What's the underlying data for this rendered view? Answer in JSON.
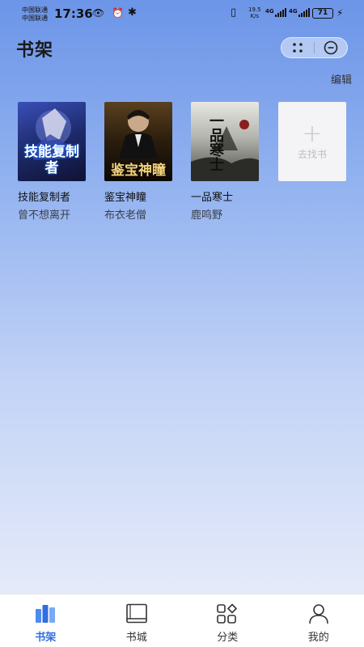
{
  "status_bar": {
    "carrier_1": "中国联通",
    "carrier_2": "中国联通",
    "time": "17:36",
    "net_speed_value": "19.5",
    "net_speed_unit": "K/s",
    "net_type_1": "4G",
    "net_type_2": "4G",
    "battery": "71"
  },
  "header": {
    "title": "书架",
    "edit_label": "编辑"
  },
  "books": [
    {
      "title": "技能复制者",
      "author": "曾不想离开",
      "cover_text": "技能复制者",
      "cover_colors": [
        "#1d2a6b",
        "#0f1233"
      ]
    },
    {
      "title": "鉴宝神瞳",
      "author": "布衣老僧",
      "cover_text": "鉴宝神瞳",
      "cover_colors": [
        "#3a2a12",
        "#0b0906"
      ]
    },
    {
      "title": "一品寒士",
      "author": "鹿鸣野",
      "cover_text": "一品寒士",
      "cover_colors": [
        "#d9d9d4",
        "#5a5a55"
      ]
    }
  ],
  "add_book": {
    "label": "去找书"
  },
  "tabbar": {
    "active_color": "#2f6fe0",
    "tabs": [
      {
        "label": "书架",
        "icon": "bookshelf-icon"
      },
      {
        "label": "书城",
        "icon": "book-store-icon"
      },
      {
        "label": "分类",
        "icon": "category-icon"
      },
      {
        "label": "我的",
        "icon": "profile-icon"
      }
    ]
  }
}
